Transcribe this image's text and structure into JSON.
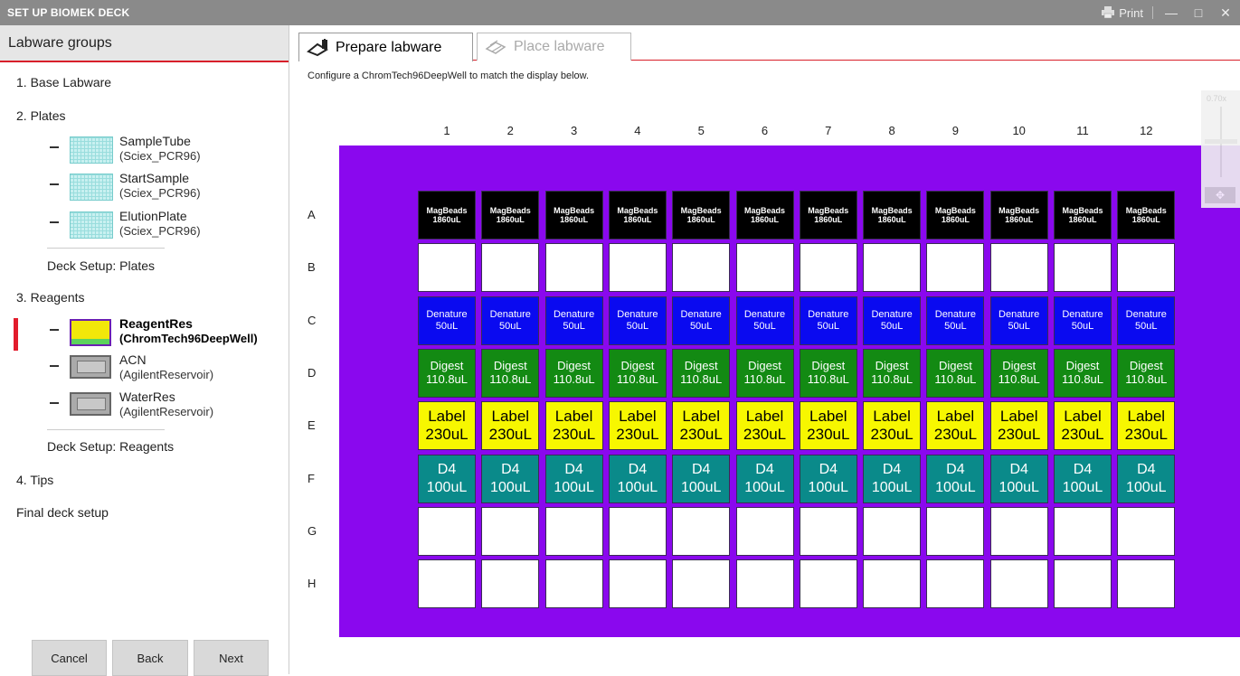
{
  "window": {
    "title": "SET UP BIOMEK DECK",
    "print_label": "Print",
    "minimize": "—",
    "maximize": "□",
    "close": "✕"
  },
  "sidebar": {
    "header": "Labware groups",
    "groups": [
      {
        "label": "1. Base Labware"
      },
      {
        "label": "2. Plates"
      },
      {
        "label": "3. Reagents"
      },
      {
        "label": "4. Tips"
      },
      {
        "label": "Final deck setup"
      }
    ],
    "plates": [
      {
        "name": "SampleTube",
        "type": "(Sciex_PCR96)",
        "icon": "plate-icon"
      },
      {
        "name": "StartSample",
        "type": "(Sciex_PCR96)",
        "icon": "plate-icon"
      },
      {
        "name": "ElutionPlate",
        "type": "(Sciex_PCR96)",
        "icon": "plate-icon"
      }
    ],
    "deck_setup_plates": "Deck Setup: Plates",
    "reagents": [
      {
        "name": "ReagentRes",
        "type": "(ChromTech96DeepWell)",
        "icon": "deepwell-icon",
        "selected": true
      },
      {
        "name": "ACN",
        "type": "(AgilentReservoir)",
        "icon": "reservoir-icon"
      },
      {
        "name": "WaterRes",
        "type": "(AgilentReservoir)",
        "icon": "reservoir-icon"
      }
    ],
    "deck_setup_reagents": "Deck Setup: Reagents",
    "buttons": {
      "cancel": "Cancel",
      "back": "Back",
      "next": "Next"
    }
  },
  "tabs": [
    {
      "label": "Prepare labware",
      "icon": "prepare-labware-icon",
      "active": true
    },
    {
      "label": "Place labware",
      "icon": "place-labware-icon",
      "active": false
    }
  ],
  "instruction": "Configure a ChromTech96DeepWell to match the display below.",
  "zoom": {
    "label": "0.70x",
    "pan_icon": "pan-icon"
  },
  "grid": {
    "columns": [
      "1",
      "2",
      "3",
      "4",
      "5",
      "6",
      "7",
      "8",
      "9",
      "10",
      "11",
      "12"
    ],
    "rows": [
      {
        "label": "A",
        "kind": "mag",
        "line1": "MagBeads",
        "line2": "1860uL"
      },
      {
        "label": "B",
        "kind": "empty",
        "line1": "",
        "line2": ""
      },
      {
        "label": "C",
        "kind": "den",
        "line1": "Denature",
        "line2": "50uL"
      },
      {
        "label": "D",
        "kind": "dig",
        "line1": "Digest",
        "line2": "110.8uL"
      },
      {
        "label": "E",
        "kind": "lab",
        "line1": "Label",
        "line2": "230uL"
      },
      {
        "label": "F",
        "kind": "d4",
        "line1": "D4",
        "line2": "100uL"
      },
      {
        "label": "G",
        "kind": "empty",
        "line1": "",
        "line2": ""
      },
      {
        "label": "H",
        "kind": "empty",
        "line1": "",
        "line2": ""
      }
    ]
  },
  "colors": {
    "plate": "#8a08ee",
    "magbeads": "#000000",
    "denature": "#0a0af0",
    "digest": "#138a13",
    "label": "#f7f700",
    "d4": "#0a8a8a",
    "accent": "#d81f2a"
  }
}
